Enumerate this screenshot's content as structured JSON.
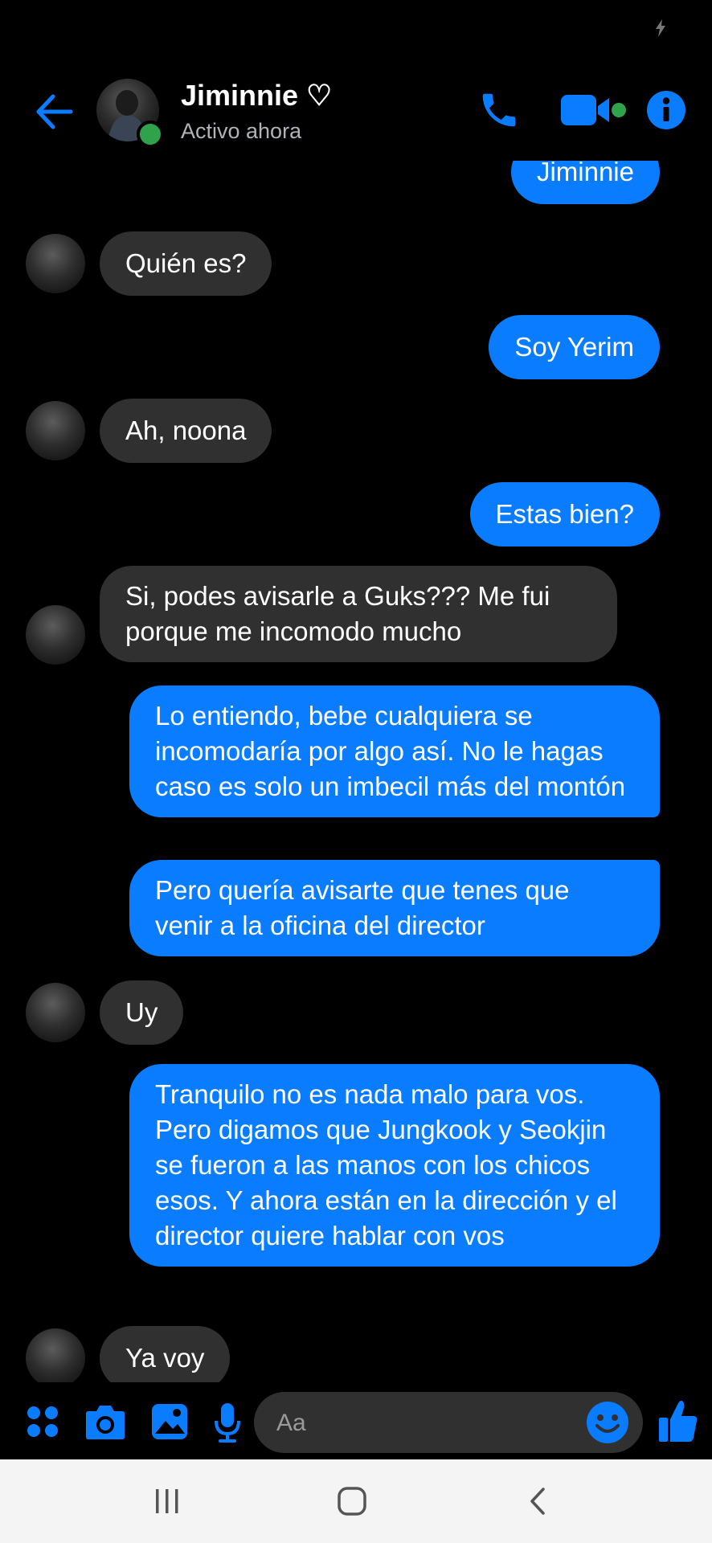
{
  "header": {
    "contact_name": "Jiminnie ♡",
    "status": "Activo ahora"
  },
  "messages": [
    {
      "from": "me",
      "text": "Jiminnie"
    },
    {
      "from": "them",
      "text": "Quién es?"
    },
    {
      "from": "me",
      "text": "Soy Yerim"
    },
    {
      "from": "them",
      "text": "Ah, noona"
    },
    {
      "from": "me",
      "text": "Estas bien?"
    },
    {
      "from": "them",
      "text": "Si, podes avisarle a Guks??? Me fui porque me incomodo mucho"
    },
    {
      "from": "me",
      "text": "Lo entiendo, bebe cualquiera se incomodaría por algo así. No le hagas caso es solo un imbecil más del montón"
    },
    {
      "from": "me",
      "text": "Pero quería avisarte que tenes que venir a la oficina del director"
    },
    {
      "from": "them",
      "text": "Uy"
    },
    {
      "from": "me",
      "text": "Tranquilo no es nada malo para vos. Pero digamos que Jungkook y Seokjin se fueron a las manos con los chicos esos. Y ahora están en la dirección y el director quiere hablar con vos"
    },
    {
      "from": "them",
      "text": "Ya voy"
    }
  ],
  "composer": {
    "placeholder": "Aa",
    "icons": [
      "apps-icon",
      "camera-icon",
      "gallery-icon",
      "mic-icon",
      "emoji-icon",
      "like-icon"
    ]
  },
  "colors": {
    "accent": "#0a7cff",
    "incoming_bubble": "#303030",
    "online": "#31a24c"
  }
}
